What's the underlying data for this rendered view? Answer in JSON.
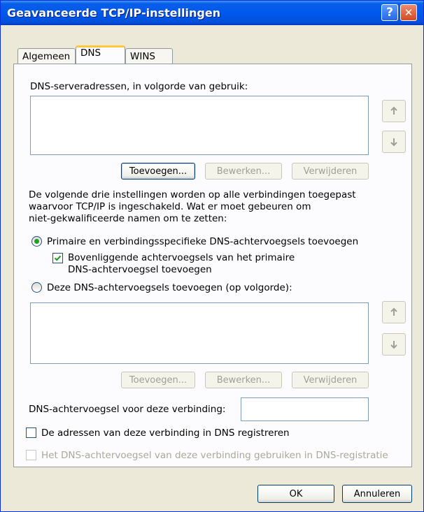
{
  "window": {
    "title": "Geavanceerde TCP/IP-instellingen",
    "help_glyph": "?",
    "close_glyph": "✕"
  },
  "tabs": [
    {
      "label": "Algemeen",
      "active": false
    },
    {
      "label": "DNS",
      "active": true
    },
    {
      "label": "WINS",
      "active": false
    }
  ],
  "dns_servers": {
    "label": "DNS-serveradressen, in volgorde van gebruik:",
    "items": [],
    "buttons": {
      "add": "Toevoegen...",
      "edit": "Bewerken...",
      "remove": "Verwijderen"
    }
  },
  "info_text": [
    "De volgende drie instellingen worden op alle verbindingen toegepast",
    "waarvoor TCP/IP is ingeschakeld. Wat er moet gebeuren om",
    "niet-gekwalificeerde namen om te zetten:"
  ],
  "option_primary": {
    "label": "Primaire en verbindingsspecifieke DNS-achtervoegsels toevoegen",
    "checked": true
  },
  "option_parent": {
    "label_line1": "Bovenliggende achtervoegsels van het primaire",
    "label_line2": "DNS-achtervoegsel toevoegen",
    "checked": true
  },
  "option_these": {
    "label": "Deze DNS-achtervoegsels toevoegen (op volgorde):",
    "checked": false
  },
  "suffix_list": {
    "items": [],
    "buttons": {
      "add": "Toevoegen...",
      "edit": "Bewerken...",
      "remove": "Verwijderen"
    }
  },
  "connection_suffix": {
    "label": "DNS-achtervoegsel voor deze verbinding:",
    "value": ""
  },
  "register_checkbox": {
    "label": "De adressen van deze verbinding in DNS registreren",
    "checked": false
  },
  "use_suffix_checkbox": {
    "label": "Het DNS-achtervoegsel van deze verbinding gebruiken in DNS-registratie",
    "checked": false,
    "disabled": true
  },
  "footer": {
    "ok": "OK",
    "cancel": "Annuleren"
  }
}
